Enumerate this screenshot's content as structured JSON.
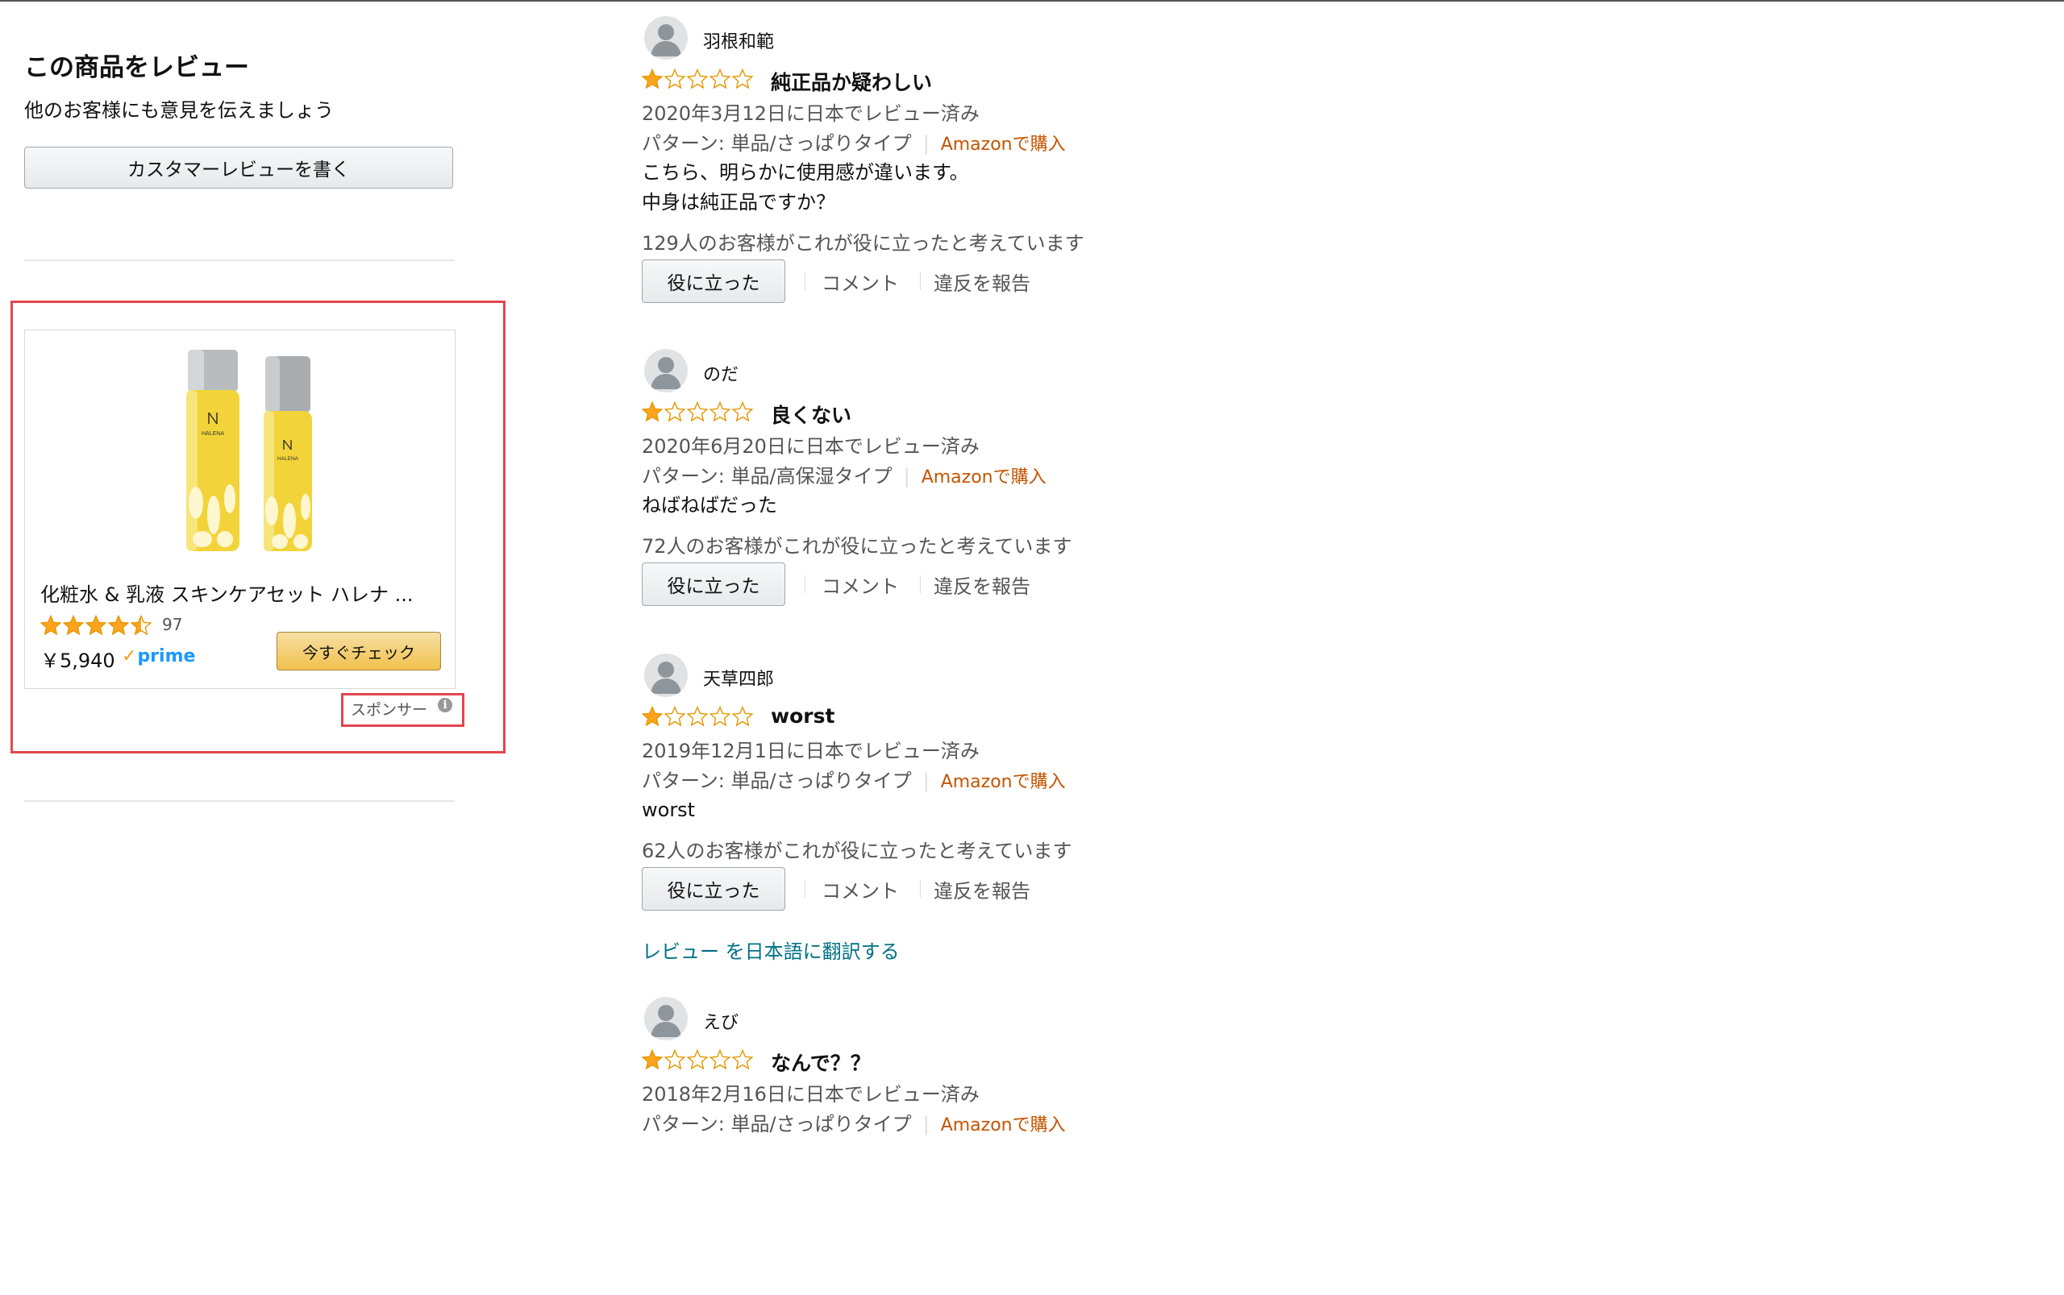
{
  "left_panel": {
    "title": "この商品をレビュー",
    "subtitle": "他のお客様にも意見を伝えましょう",
    "write_review_button": "カスタマーレビューを書く"
  },
  "sponsored_ad": {
    "product_title": "化粧水 & 乳液 スキンケアセット ハレナ ...",
    "rating_stars": 4.5,
    "rating_count": "97",
    "price": "￥5,940",
    "prime_label": "prime",
    "check_button": "今すぐチェック",
    "sponsor_label": "スポンサー",
    "product_brand_text": "HALENA",
    "colors": {
      "bottle": "#f2d43a",
      "cap": "#b8bcbf"
    }
  },
  "reviews": [
    {
      "reviewer": "羽根和範",
      "stars": 1,
      "title": "純正品か疑わしい",
      "date": "2020年3月12日に日本でレビュー済み",
      "pattern": "パターン: 単品/さっぱりタイプ",
      "verified": "Amazonで購入",
      "body": [
        "こちら、明らかに使用感が違います。",
        "中身は純正品ですか？"
      ],
      "helpful": "129人のお客様がこれが役に立ったと考えています",
      "helpful_button": "役に立った",
      "comment": "コメント",
      "report": "違反を報告"
    },
    {
      "reviewer": "のだ",
      "stars": 1,
      "title": "良くない",
      "date": "2020年6月20日に日本でレビュー済み",
      "pattern": "パターン: 単品/高保湿タイプ",
      "verified": "Amazonで購入",
      "body": [
        "ねばねばだった"
      ],
      "helpful": "72人のお客様がこれが役に立ったと考えています",
      "helpful_button": "役に立った",
      "comment": "コメント",
      "report": "違反を報告"
    },
    {
      "reviewer": "天草四郎",
      "stars": 1,
      "title": "worst",
      "date": "2019年12月1日に日本でレビュー済み",
      "pattern": "パターン: 単品/さっぱりタイプ",
      "verified": "Amazonで購入",
      "body": [
        "worst"
      ],
      "helpful": "62人のお客様がこれが役に立ったと考えています",
      "helpful_button": "役に立った",
      "comment": "コメント",
      "report": "違反を報告",
      "translate_link": "レビュー を日本語に翻訳する"
    },
    {
      "reviewer": "えび",
      "stars": 1,
      "title": "なんで？？",
      "date": "2018年2月16日に日本でレビュー済み",
      "pattern": "パターン: 単品/さっぱりタイプ",
      "verified": "Amazonで購入"
    }
  ],
  "colors": {
    "star_fill": "#ffa41c",
    "link": "#007185",
    "verified": "#c45500",
    "highlight_border": "#e2464f",
    "prime": "#1a98ff"
  }
}
